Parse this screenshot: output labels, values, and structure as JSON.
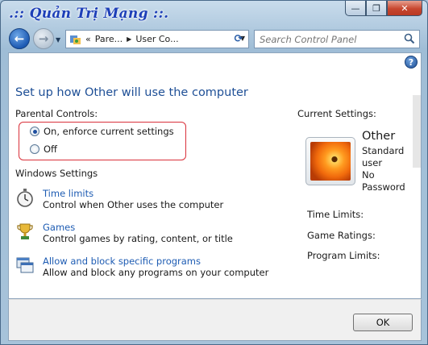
{
  "watermark": ".:: Quản Trị Mạng ::.",
  "titlebar": {
    "minimize_label": "—",
    "maximize_label": "❐",
    "close_label": "✕"
  },
  "nav": {
    "back_label": "←",
    "forward_label": "→",
    "address_overflow": "«",
    "breadcrumb": [
      "Pare...",
      "User Co..."
    ],
    "search_placeholder": "Search Control Panel"
  },
  "help_label": "?",
  "main": {
    "title": "Set up how Other will use the computer",
    "parental_controls_label": "Parental Controls:",
    "radio_options": [
      {
        "label": "On, enforce current settings",
        "selected": true
      },
      {
        "label": "Off",
        "selected": false
      }
    ],
    "windows_settings_label": "Windows Settings",
    "settings": [
      {
        "link": "Time limits",
        "desc": "Control when Other uses the computer",
        "icon": "stopwatch-icon"
      },
      {
        "link": "Games",
        "desc": "Control games by rating, content, or title",
        "icon": "trophy-icon"
      },
      {
        "link": "Allow and block specific programs",
        "desc": "Allow and block any programs on your computer",
        "icon": "programs-icon"
      }
    ]
  },
  "current_settings": {
    "label": "Current Settings:",
    "user_name": "Other",
    "user_type_line1": "Standard",
    "user_type_line2": "user",
    "password_line1": "No",
    "password_line2": "Password",
    "time_limits_label": "Time Limits:",
    "game_ratings_label": "Game Ratings:",
    "program_limits_label": "Program Limits:"
  },
  "footer": {
    "ok_label": "OK"
  },
  "colors": {
    "link": "#1e5cb3",
    "title": "#1e4f96",
    "highlight_box": "#d9303a"
  }
}
